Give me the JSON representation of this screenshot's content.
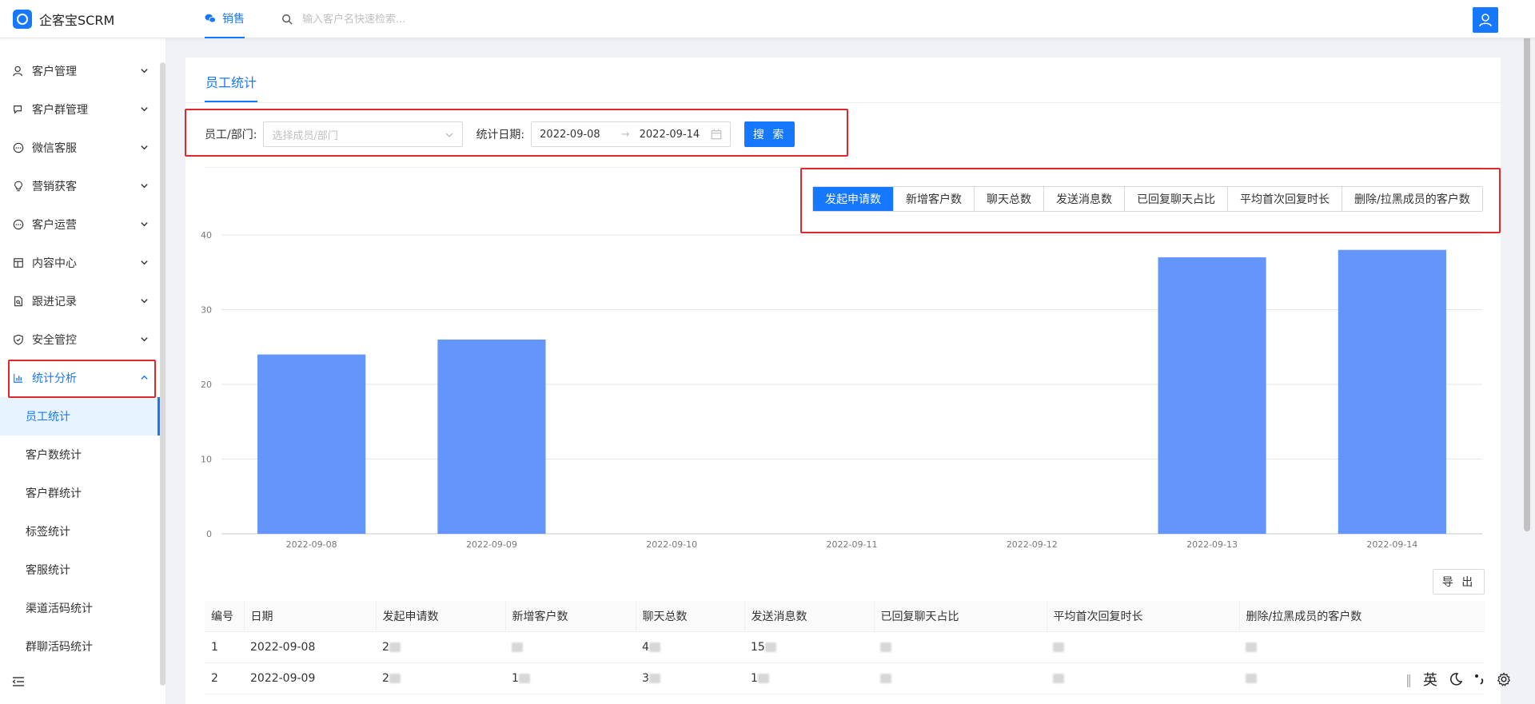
{
  "app": {
    "name": "企客宝SCRM"
  },
  "topbar": {
    "tab_label": "销售",
    "search_placeholder": "输入客户名快速检索..."
  },
  "sidebar": {
    "menu": [
      {
        "label": "客户管理",
        "icon": "user-icon"
      },
      {
        "label": "客户群管理",
        "icon": "chat-icon"
      },
      {
        "label": "微信客服",
        "icon": "message-icon"
      },
      {
        "label": "营销获客",
        "icon": "bulb-icon"
      },
      {
        "label": "客户运营",
        "icon": "message-icon"
      },
      {
        "label": "内容中心",
        "icon": "layout-icon"
      },
      {
        "label": "跟进记录",
        "icon": "file-search-icon"
      },
      {
        "label": "安全管控",
        "icon": "shield-icon"
      },
      {
        "label": "统计分析",
        "icon": "bar-chart-icon"
      }
    ],
    "sub_items": [
      "员工统计",
      "客户数统计",
      "客户群统计",
      "标签统计",
      "客服统计",
      "渠道活码统计",
      "群聊活码统计"
    ]
  },
  "page": {
    "tab_title": "员工统计",
    "filter": {
      "member_label": "员工/部门:",
      "member_placeholder": "选择成员/部门",
      "date_label": "统计日期:",
      "date_start": "2022-09-08",
      "date_end": "2022-09-14",
      "search_button": "搜 索"
    },
    "metric_tabs": [
      "发起申请数",
      "新增客户数",
      "聊天总数",
      "发送消息数",
      "已回复聊天占比",
      "平均首次回复时长",
      "删除/拉黑成员的客户数"
    ],
    "active_metric": 0,
    "export_button": "导 出",
    "table": {
      "headers": [
        "编号",
        "日期",
        "发起申请数",
        "新增客户数",
        "聊天总数",
        "发送消息数",
        "已回复聊天占比",
        "平均首次回复时长",
        "删除/拉黑成员的客户数"
      ],
      "rows": [
        {
          "no": "1",
          "date": "2022-09-08",
          "c2": "2",
          "c4": "4",
          "c5": "15"
        },
        {
          "no": "2",
          "date": "2022-09-09",
          "c2": "2",
          "c3": "1",
          "c4": "3",
          "c5": "1"
        }
      ]
    }
  },
  "chart_data": {
    "type": "bar",
    "categories": [
      "2022-09-08",
      "2022-09-09",
      "2022-09-10",
      "2022-09-11",
      "2022-09-12",
      "2022-09-13",
      "2022-09-14"
    ],
    "values": [
      24,
      26,
      0,
      0,
      0,
      37,
      38
    ],
    "yticks": [
      "0",
      "10",
      "20",
      "30",
      "40"
    ],
    "ylim": [
      0,
      40
    ],
    "color": "#6495fa",
    "grid": true
  },
  "ime": {
    "lang": "英"
  }
}
